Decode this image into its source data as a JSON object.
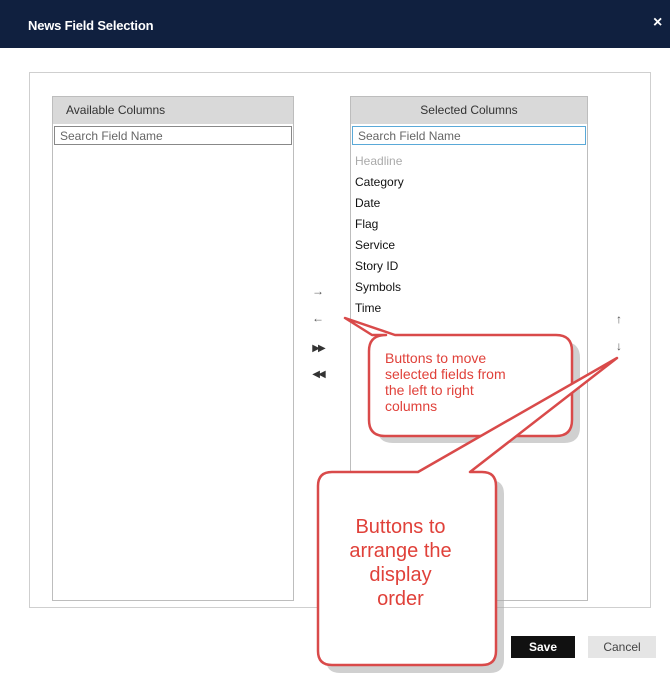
{
  "dialog": {
    "title": "News Field Selection",
    "close": "×"
  },
  "available": {
    "header": "Available Columns",
    "search_placeholder": "Search Field Name"
  },
  "selected": {
    "header": "Selected Columns",
    "search_placeholder": "Search Field Name",
    "items": [
      "Headline",
      "Category",
      "Date",
      "Flag",
      "Service",
      "Story ID",
      "Symbols",
      "Time"
    ]
  },
  "move_buttons": {
    "right": "→",
    "left": "←",
    "all_right": "▶▶",
    "all_left": "◀◀"
  },
  "order_buttons": {
    "up": "↑",
    "down": "↓"
  },
  "actions": {
    "save": "Save",
    "cancel": "Cancel"
  },
  "callouts": {
    "move": [
      "Buttons to move",
      "selected fields from",
      "the left to right",
      "columns"
    ],
    "order": [
      "Buttons to",
      "arrange the",
      "display",
      "order"
    ]
  },
  "colors": {
    "titlebar": "#10203f",
    "callout_stroke": "#d94a4a",
    "callout_text": "#e0413a",
    "save_bg": "#111111"
  }
}
